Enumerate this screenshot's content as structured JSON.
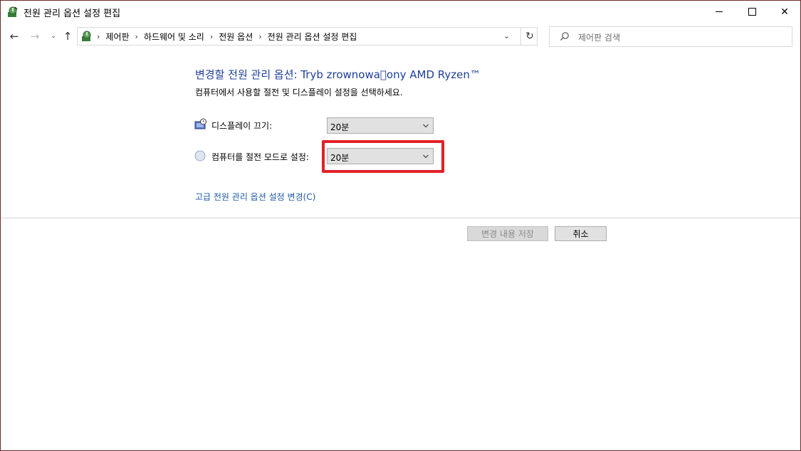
{
  "window": {
    "title": "전원 관리 옵션 설정 편집",
    "controls": {
      "minimize": "minimize",
      "maximize": "maximize",
      "close": "✕"
    }
  },
  "navigation": {
    "back": "←",
    "forward": "→",
    "recent": "⌄",
    "up": "↑"
  },
  "address": {
    "breadcrumbs": [
      "제어판",
      "하드웨어 및 소리",
      "전원 옵션",
      "전원 관리 옵션 설정 편집"
    ],
    "separator": "›",
    "dropdown": "⌄",
    "refresh": "↻"
  },
  "search": {
    "placeholder": "제어판 검색"
  },
  "main": {
    "heading": "변경할 전원 관리 옵션: Tryb zrownowa\u0000ony AMD Ryzen™",
    "subheading": "컴퓨터에서 사용할 절전 및 디스플레이 설정을 선택하세요.",
    "display_off": {
      "label": "디스플레이 끄기:",
      "value": "20분"
    },
    "sleep": {
      "label": "컴퓨터를 절전 모드로 설정:",
      "value": "20분"
    },
    "advanced_link": "고급 전원 관리 옵션 설정 변경(C)"
  },
  "buttons": {
    "save": "변경 내용 저장",
    "cancel": "취소"
  },
  "colors": {
    "heading": "#1e3f9a",
    "link": "#1e5aa8",
    "highlight": "#e21f26"
  }
}
